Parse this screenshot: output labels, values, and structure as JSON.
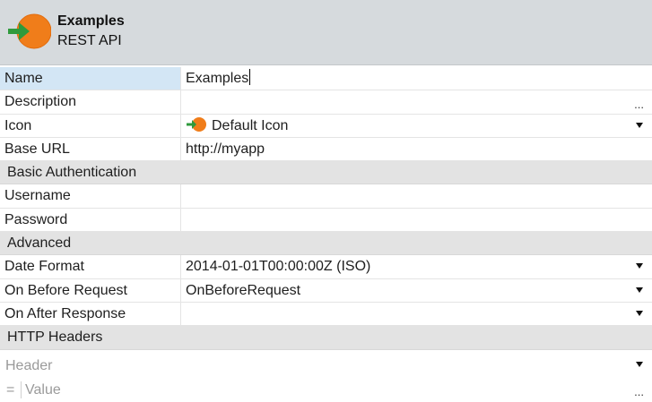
{
  "header": {
    "title": "Examples",
    "subtitle": "REST API",
    "icon": "rest-api-logo-icon"
  },
  "properties": {
    "name": {
      "label": "Name",
      "value": "Examples"
    },
    "description": {
      "label": "Description",
      "value": "",
      "button": "..."
    },
    "icon": {
      "label": "Icon",
      "value": "Default Icon"
    },
    "base_url": {
      "label": "Base URL",
      "value": "http://myapp"
    }
  },
  "sections": {
    "basic_auth": "Basic Authentication",
    "advanced": "Advanced",
    "http_headers": "HTTP Headers"
  },
  "auth": {
    "username": {
      "label": "Username",
      "value": ""
    },
    "password": {
      "label": "Password",
      "value": ""
    }
  },
  "advanced": {
    "date_format": {
      "label": "Date Format",
      "value": "2014-01-01T00:00:00Z (ISO)"
    },
    "on_before_request": {
      "label": "On Before Request",
      "value": "OnBeforeRequest"
    },
    "on_after_response": {
      "label": "On After Response",
      "value": ""
    }
  },
  "http_headers": {
    "header_placeholder": "Header",
    "equals_sign": "=",
    "value_placeholder": "Value",
    "value_button": "..."
  },
  "colors": {
    "header_bg": "#d6dadd",
    "section_bg": "#e3e3e3",
    "selected_label_bg": "#d3e6f5",
    "logo_orange": "#f07d1a",
    "arrow_green": "#2f9a3c"
  }
}
